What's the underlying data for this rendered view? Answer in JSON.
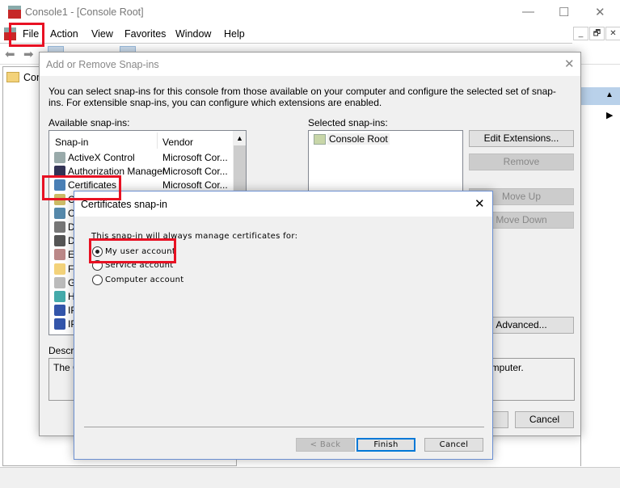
{
  "window": {
    "title": "Console1 - [Console Root]",
    "minimize": "—",
    "maximize": "☐",
    "close": "✕"
  },
  "menu": [
    "File",
    "Action",
    "View",
    "Favorites",
    "Window",
    "Help"
  ],
  "mdi_controls": [
    "_",
    "🗗",
    "✕"
  ],
  "tree": {
    "root": "Con"
  },
  "snapin_dialog": {
    "title": "Add or Remove Snap-ins",
    "intro": "You can select snap-ins for this console from those available on your computer and configure the selected set of snap-ins. For extensible snap-ins, you can configure which extensions are enabled.",
    "available_label": "Available snap-ins:",
    "columns": [
      "Snap-in",
      "Vendor"
    ],
    "rows": [
      {
        "name": "ActiveX Control",
        "vendor": "Microsoft Cor..."
      },
      {
        "name": "Authorization Manager",
        "vendor": "Microsoft Cor..."
      },
      {
        "name": "Certificates",
        "vendor": "Microsoft Cor..."
      },
      {
        "name": "C",
        "vendor": ""
      },
      {
        "name": "C",
        "vendor": ""
      },
      {
        "name": "D",
        "vendor": ""
      },
      {
        "name": "D",
        "vendor": ""
      },
      {
        "name": "Ev",
        "vendor": ""
      },
      {
        "name": "Fo",
        "vendor": ""
      },
      {
        "name": "G",
        "vendor": ""
      },
      {
        "name": "H",
        "vendor": ""
      },
      {
        "name": "IP",
        "vendor": ""
      },
      {
        "name": "IP",
        "vendor": ""
      }
    ],
    "selected_label": "Selected snap-ins:",
    "selected": [
      "Console Root"
    ],
    "buttons": {
      "edit_extensions": "Edit Extensions...",
      "remove": "Remove",
      "move_up": "Move Up",
      "move_down": "Move Down",
      "advanced": "Advanced...",
      "cancel": "Cancel"
    },
    "description_label": "Descrip",
    "description_start": "The C",
    "description_end": "omputer."
  },
  "cert_dialog": {
    "title": "Certificates snap-in",
    "prompt": "This snap-in will always manage certificates for:",
    "options": [
      {
        "label": "My user account",
        "selected": true
      },
      {
        "label": "Service account",
        "selected": false
      },
      {
        "label": "Computer account",
        "selected": false
      }
    ],
    "buttons": {
      "back": "< Back",
      "finish": "Finish",
      "cancel": "Cancel"
    }
  },
  "colors": {
    "highlight": "#e81123",
    "finish_border": "#0078d7",
    "actions_header": "#b9d1ea"
  }
}
